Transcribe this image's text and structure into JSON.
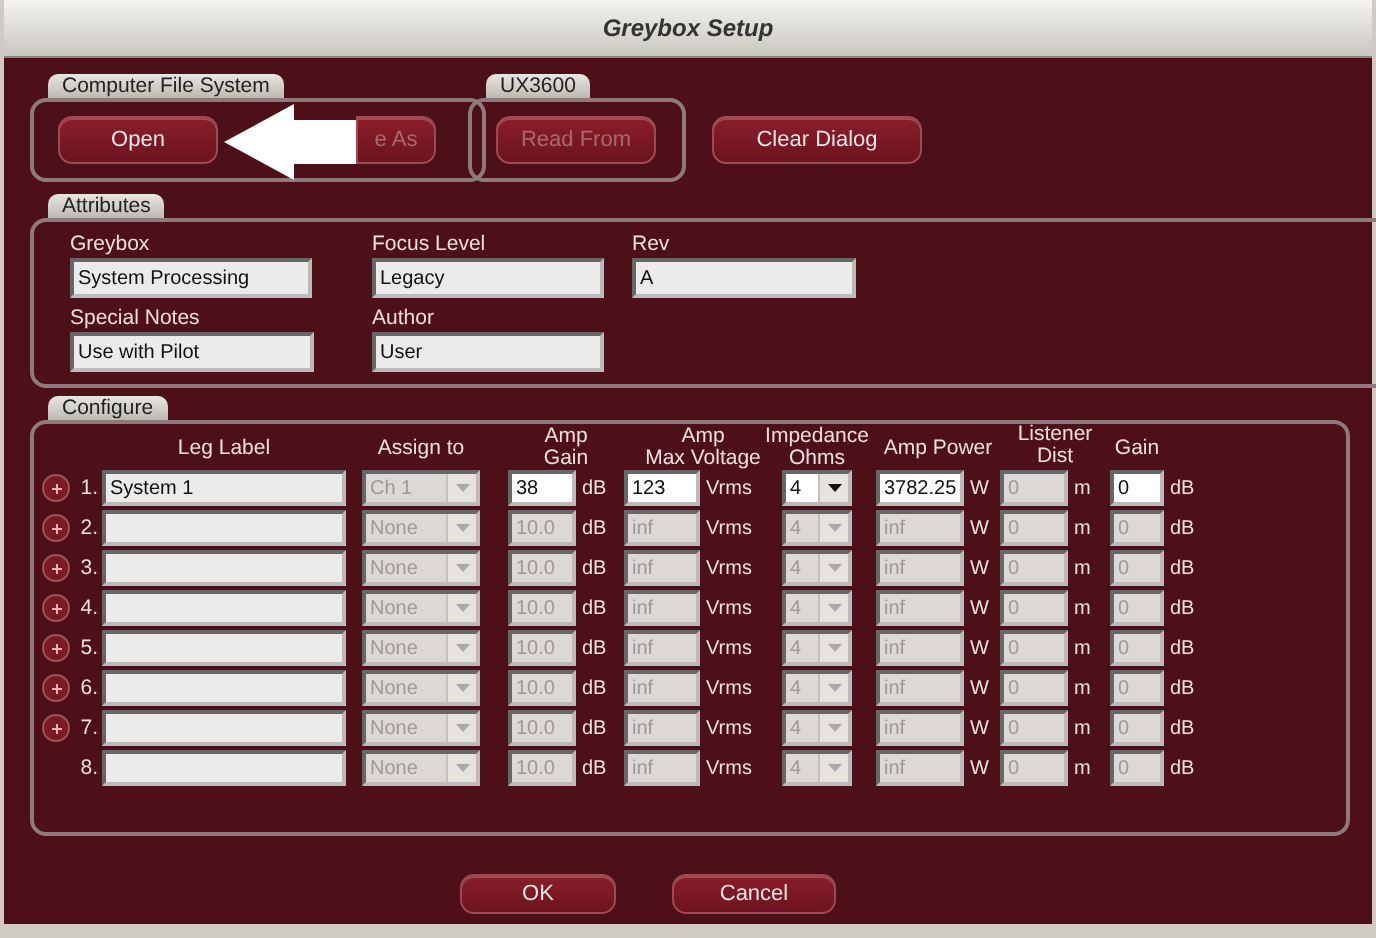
{
  "window": {
    "title": "Greybox Setup"
  },
  "file_groups": [
    {
      "tab": "Computer File System",
      "buttons": [
        {
          "label": "Open",
          "disabled": false
        },
        {
          "label": "e As",
          "disabled": true
        }
      ]
    },
    {
      "tab": "UX3600",
      "buttons": [
        {
          "label": "Read From",
          "disabled": true
        }
      ]
    }
  ],
  "clear_button": {
    "label": "Clear Dialog",
    "disabled": false
  },
  "attributes": {
    "tab": "Attributes",
    "fields": [
      {
        "label": "Greybox",
        "value": "System Processing"
      },
      {
        "label": "Focus Level",
        "value": "Legacy"
      },
      {
        "label": "Rev",
        "value": "A"
      },
      {
        "label": "Special Notes",
        "value": "Use with Pilot"
      },
      {
        "label": "Author",
        "value": "User"
      }
    ]
  },
  "configure": {
    "tab": "Configure",
    "columns": [
      {
        "header": "Leg Label",
        "kind": "text"
      },
      {
        "header": "Assign to",
        "kind": "select"
      },
      {
        "header": "Amp\nGain",
        "kind": "number"
      },
      {
        "header": "Amp\nMax Voltage",
        "kind": "number"
      },
      {
        "header": "Impedance\nOhms",
        "kind": "select"
      },
      {
        "header": "Amp Power",
        "kind": "number"
      },
      {
        "header": "Listener Dist",
        "kind": "number"
      },
      {
        "header": "Gain",
        "kind": "number"
      }
    ],
    "rows": [
      {
        "add_button": true,
        "number": "1.",
        "cells": [
          {
            "value": "System 1",
            "disabled": false
          },
          {
            "value": "Ch 1",
            "disabled": true
          },
          {
            "value": "38",
            "unit": "dB",
            "disabled": false
          },
          {
            "value": "123",
            "unit": "Vrms",
            "disabled": false
          },
          {
            "value": "4",
            "disabled": false
          },
          {
            "value": "3782.25",
            "unit": "W",
            "disabled": false
          },
          {
            "value": "0",
            "unit": "m",
            "disabled": true
          },
          {
            "value": "0",
            "unit": "dB",
            "disabled": false
          }
        ]
      },
      {
        "add_button": true,
        "number": "2.",
        "cells": [
          {
            "disabled": false
          },
          {
            "value": "None",
            "disabled": true
          },
          {
            "value": "10.0",
            "unit": "dB",
            "disabled": true
          },
          {
            "value": "inf",
            "unit": "Vrms",
            "disabled": true
          },
          {
            "value": "4",
            "disabled": true
          },
          {
            "value": "inf",
            "unit": "W",
            "disabled": true
          },
          {
            "value": "0",
            "unit": "m",
            "disabled": true
          },
          {
            "value": "0",
            "unit": "dB",
            "disabled": true
          }
        ]
      },
      {
        "add_button": true,
        "number": "3.",
        "cells": [
          {
            "disabled": false
          },
          {
            "value": "None",
            "disabled": true
          },
          {
            "value": "10.0",
            "unit": "dB",
            "disabled": true
          },
          {
            "value": "inf",
            "unit": "Vrms",
            "disabled": true
          },
          {
            "value": "4",
            "disabled": true
          },
          {
            "value": "inf",
            "unit": "W",
            "disabled": true
          },
          {
            "value": "0",
            "unit": "m",
            "disabled": true
          },
          {
            "value": "0",
            "unit": "dB",
            "disabled": true
          }
        ]
      },
      {
        "add_button": true,
        "number": "4.",
        "cells": [
          {
            "disabled": false
          },
          {
            "value": "None",
            "disabled": true
          },
          {
            "value": "10.0",
            "unit": "dB",
            "disabled": true
          },
          {
            "value": "inf",
            "unit": "Vrms",
            "disabled": true
          },
          {
            "value": "4",
            "disabled": true
          },
          {
            "value": "inf",
            "unit": "W",
            "disabled": true
          },
          {
            "value": "0",
            "unit": "m",
            "disabled": true
          },
          {
            "value": "0",
            "unit": "dB",
            "disabled": true
          }
        ]
      },
      {
        "add_button": true,
        "number": "5.",
        "cells": [
          {
            "disabled": false
          },
          {
            "value": "None",
            "disabled": true
          },
          {
            "value": "10.0",
            "unit": "dB",
            "disabled": true
          },
          {
            "value": "inf",
            "unit": "Vrms",
            "disabled": true
          },
          {
            "value": "4",
            "disabled": true
          },
          {
            "value": "inf",
            "unit": "W",
            "disabled": true
          },
          {
            "value": "0",
            "unit": "m",
            "disabled": true
          },
          {
            "value": "0",
            "unit": "dB",
            "disabled": true
          }
        ]
      },
      {
        "add_button": true,
        "number": "6.",
        "cells": [
          {
            "disabled": false
          },
          {
            "value": "None",
            "disabled": true
          },
          {
            "value": "10.0",
            "unit": "dB",
            "disabled": true
          },
          {
            "value": "inf",
            "unit": "Vrms",
            "disabled": true
          },
          {
            "value": "4",
            "disabled": true
          },
          {
            "value": "inf",
            "unit": "W",
            "disabled": true
          },
          {
            "value": "0",
            "unit": "m",
            "disabled": true
          },
          {
            "value": "0",
            "unit": "dB",
            "disabled": true
          }
        ]
      },
      {
        "add_button": true,
        "number": "7.",
        "cells": [
          {
            "disabled": false
          },
          {
            "value": "None",
            "disabled": true
          },
          {
            "value": "10.0",
            "unit": "dB",
            "disabled": true
          },
          {
            "value": "inf",
            "unit": "Vrms",
            "disabled": true
          },
          {
            "value": "4",
            "disabled": true
          },
          {
            "value": "inf",
            "unit": "W",
            "disabled": true
          },
          {
            "value": "0",
            "unit": "m",
            "disabled": true
          },
          {
            "value": "0",
            "unit": "dB",
            "disabled": true
          }
        ]
      },
      {
        "add_button": false,
        "number": "8.",
        "cells": [
          {
            "disabled": false
          },
          {
            "value": "None",
            "disabled": true
          },
          {
            "value": "10.0",
            "unit": "dB",
            "disabled": true
          },
          {
            "value": "inf",
            "unit": "Vrms",
            "disabled": true
          },
          {
            "value": "4",
            "disabled": true
          },
          {
            "value": "inf",
            "unit": "W",
            "disabled": true
          },
          {
            "value": "0",
            "unit": "m",
            "disabled": true
          },
          {
            "value": "0",
            "unit": "dB",
            "disabled": true
          }
        ]
      }
    ]
  },
  "footer_buttons": [
    {
      "label": "OK"
    },
    {
      "label": "Cancel"
    }
  ]
}
